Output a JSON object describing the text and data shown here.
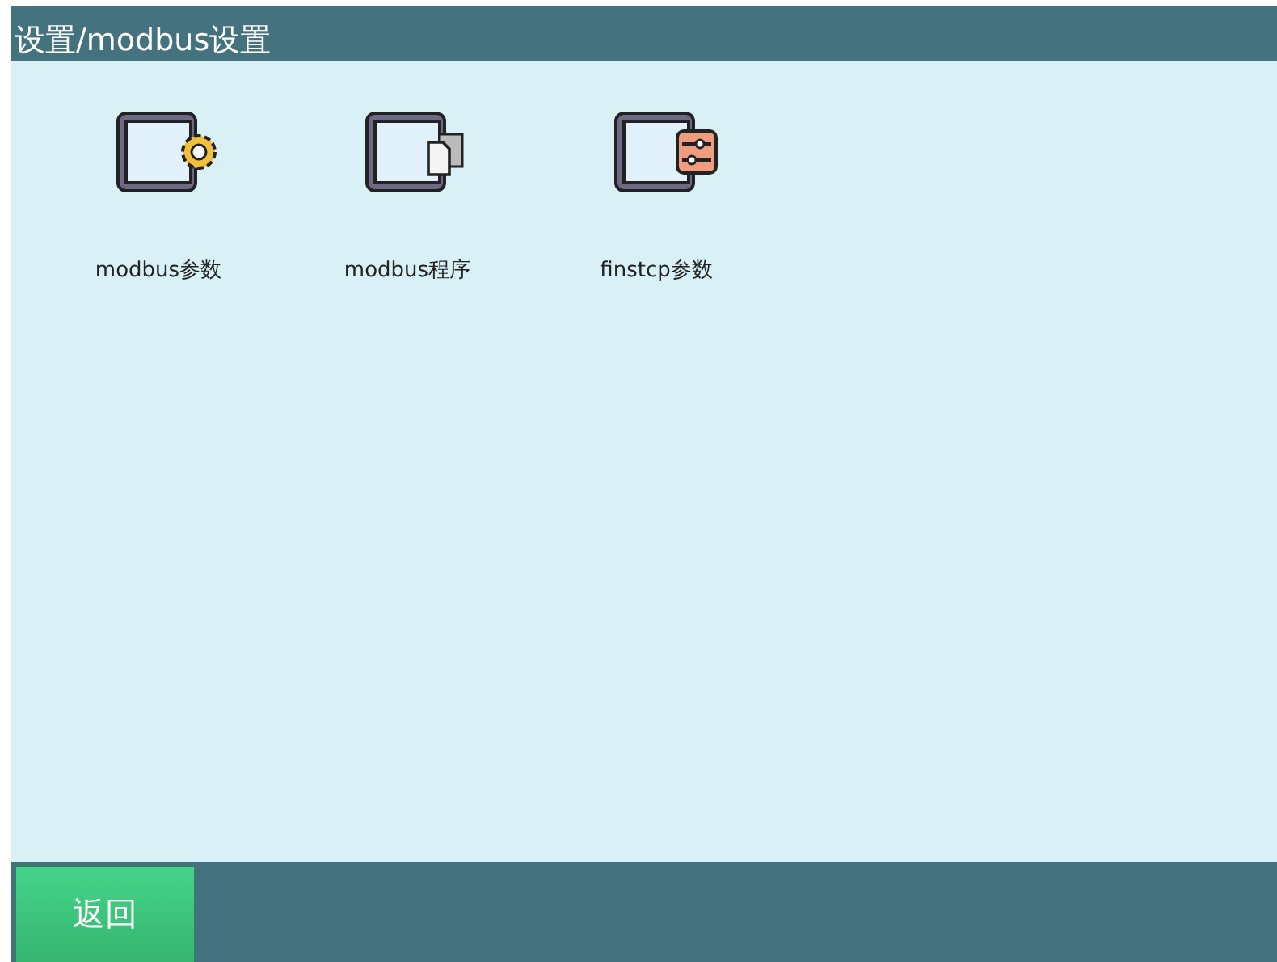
{
  "header": {
    "title": "设置/modbus设置"
  },
  "items": [
    {
      "label": "modbus参数",
      "kind": "gear"
    },
    {
      "label": "modbus程序",
      "kind": "document"
    },
    {
      "label": "finstcp参数",
      "kind": "sliders"
    }
  ],
  "footer": {
    "back_button": "返回"
  }
}
